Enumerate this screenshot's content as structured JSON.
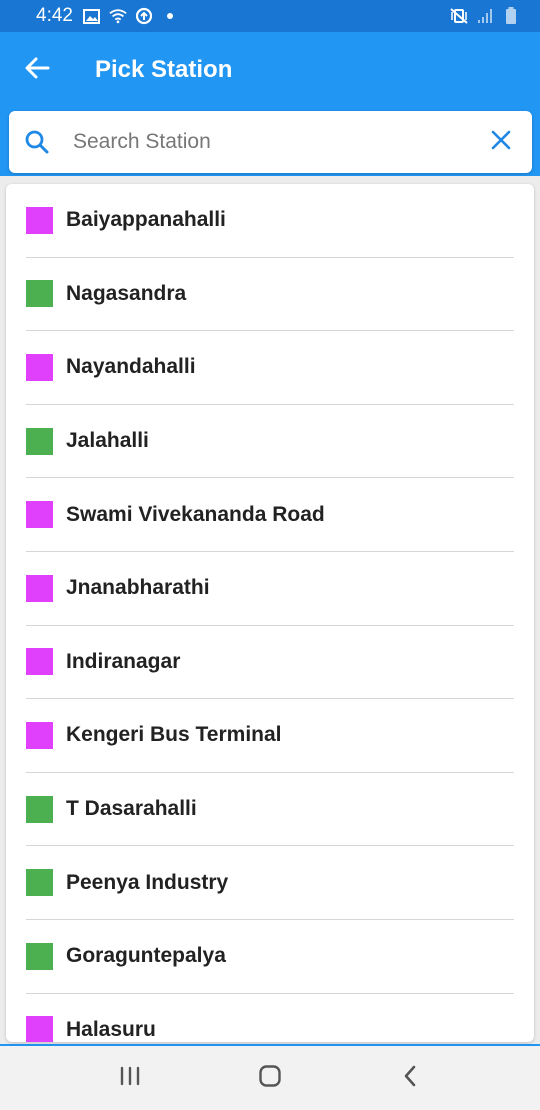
{
  "status_bar": {
    "time": "4:42",
    "left_icons": [
      "image-icon",
      "wifi-icon",
      "data-saver-icon",
      "dot-icon"
    ],
    "right_icons": [
      "mute-vibrate-icon",
      "signal-icon",
      "battery-icon"
    ]
  },
  "app_bar": {
    "title": "Pick Station",
    "back_icon": "arrow-left-icon"
  },
  "search": {
    "placeholder": "Search Station",
    "value": "",
    "search_icon": "search-icon",
    "clear_icon": "close-icon"
  },
  "colors": {
    "primary": "#2196f3",
    "status_bar": "#1976d2",
    "purple_line": "#e040fb",
    "green_line": "#4caf50"
  },
  "stations": [
    {
      "name": "Baiyappanahalli",
      "line": "purple"
    },
    {
      "name": "Nagasandra",
      "line": "green"
    },
    {
      "name": "Nayandahalli",
      "line": "purple"
    },
    {
      "name": "Jalahalli",
      "line": "green"
    },
    {
      "name": "Swami Vivekananda Road",
      "line": "purple"
    },
    {
      "name": "Jnanabharathi",
      "line": "purple"
    },
    {
      "name": "Indiranagar",
      "line": "purple"
    },
    {
      "name": "Kengeri Bus Terminal",
      "line": "purple"
    },
    {
      "name": "T Dasarahalli",
      "line": "green"
    },
    {
      "name": "Peenya Industry",
      "line": "green"
    },
    {
      "name": "Goraguntepalya",
      "line": "green"
    },
    {
      "name": "Halasuru",
      "line": "purple"
    }
  ],
  "nav_bar": {
    "buttons": [
      "recent-apps-icon",
      "home-icon",
      "back-icon"
    ]
  }
}
